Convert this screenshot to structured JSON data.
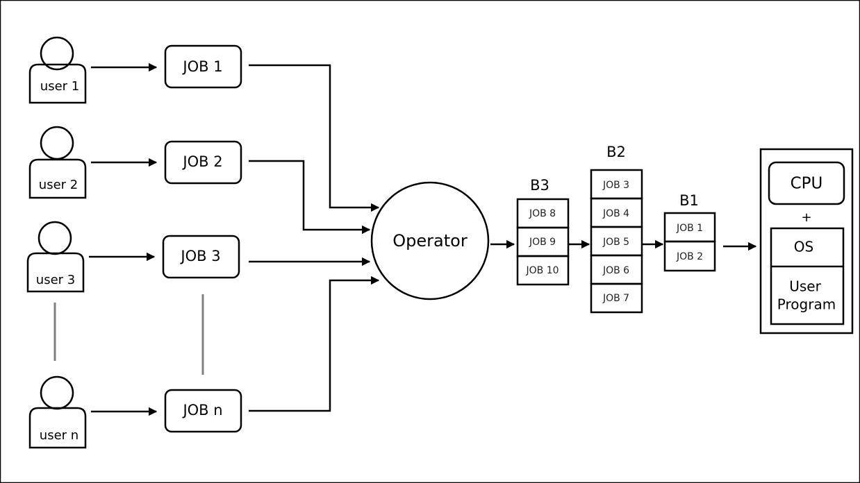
{
  "users": [
    "user 1",
    "user 2",
    "user 3",
    "user n"
  ],
  "jobs": [
    "JOB 1",
    "JOB 2",
    "JOB 3",
    "JOB n"
  ],
  "operator": "Operator",
  "buffers": {
    "b3": {
      "label": "B3",
      "items": [
        "JOB 8",
        "JOB 9",
        "JOB 10"
      ]
    },
    "b2": {
      "label": "B2",
      "items": [
        "JOB 3",
        "JOB 4",
        "JOB 5",
        "JOB 6",
        "JOB 7"
      ]
    },
    "b1": {
      "label": "B1",
      "items": [
        "JOB 1",
        "JOB 2"
      ]
    }
  },
  "computer": {
    "cpu": "CPU",
    "plus": "+",
    "os": "OS",
    "user_program_line1": "User",
    "user_program_line2": "Program"
  },
  "colors": {
    "stroke": "#000000",
    "continuation_line": "#808080"
  }
}
